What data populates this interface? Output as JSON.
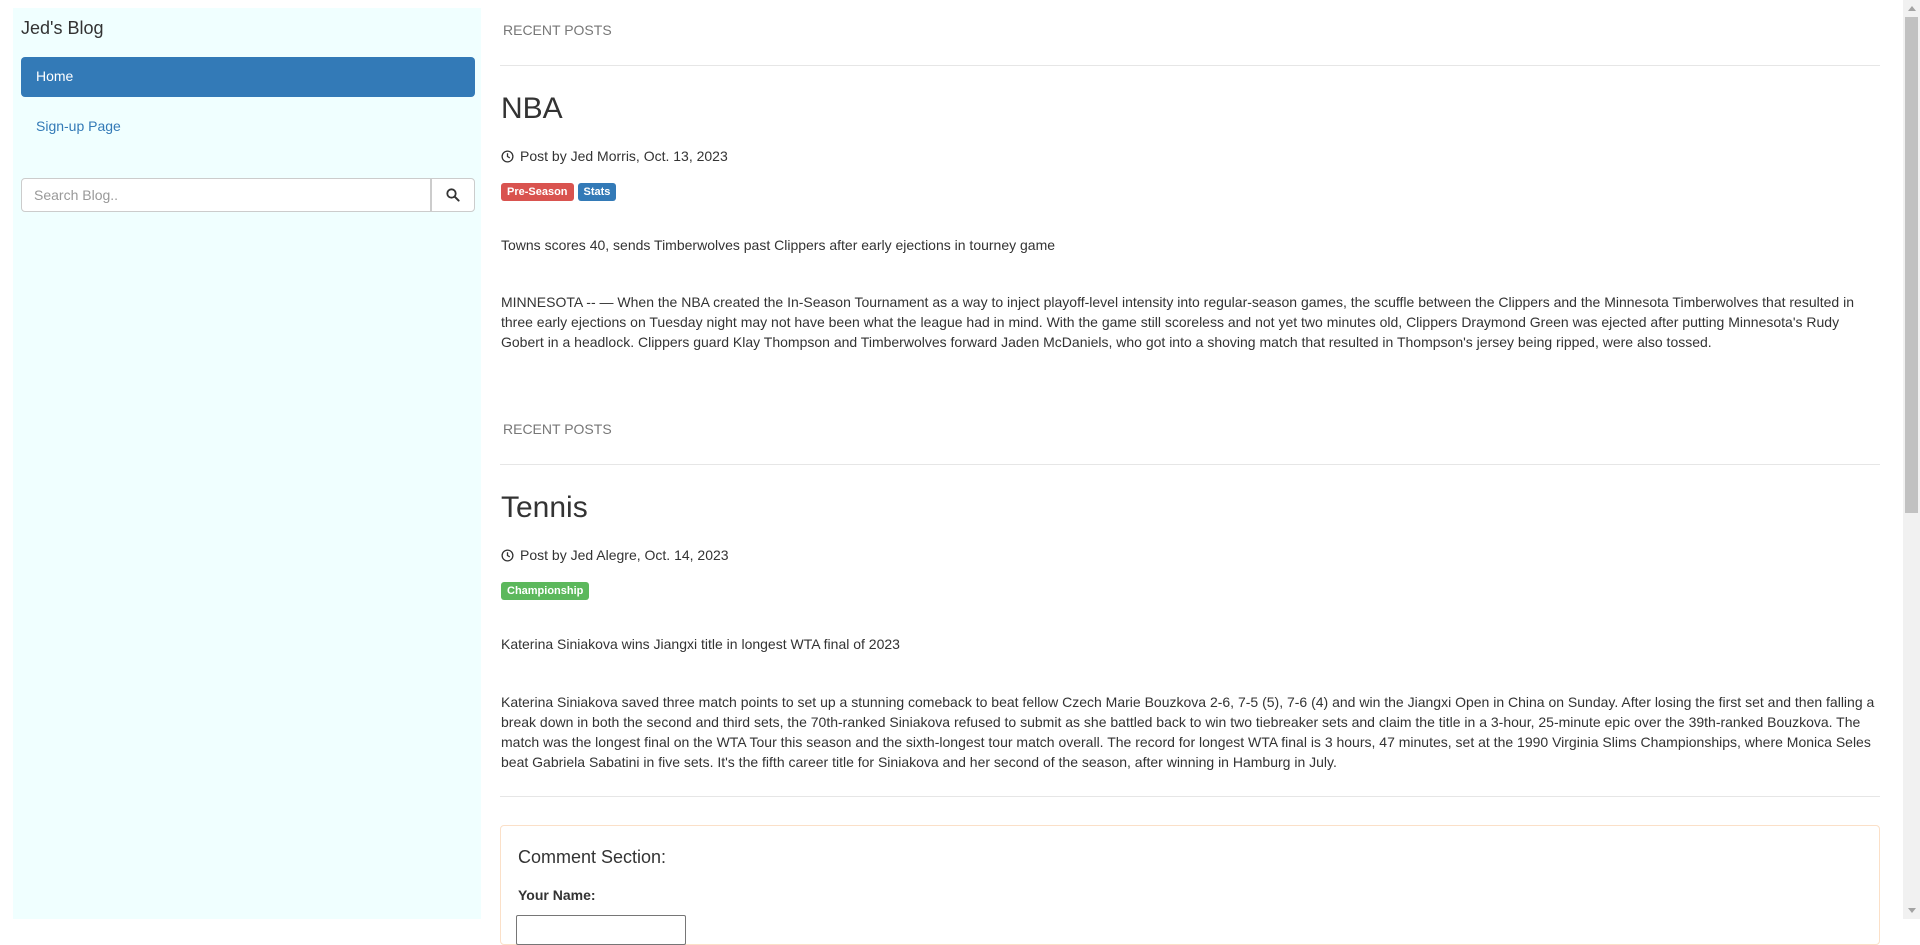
{
  "sidebar": {
    "blog_title": "Jed's Blog",
    "nav": [
      {
        "label": "Home",
        "active": true
      },
      {
        "label": "Sign-up Page",
        "active": false
      }
    ],
    "search": {
      "placeholder": "Search Blog..",
      "button_icon": "search-icon"
    }
  },
  "posts": [
    {
      "section_label": "RECENT POSTS",
      "title": "NBA",
      "meta_icon": "clock-icon",
      "meta": "Post by Jed Morris, Oct. 13, 2023",
      "tags": [
        {
          "label": "Pre-Season",
          "color": "#d9534f"
        },
        {
          "label": "Stats",
          "color": "#337ab7"
        }
      ],
      "subtitle": "Towns scores 40, sends Timberwolves past Clippers after early ejections in tourney game",
      "body": "MINNESOTA -- — When the NBA created the In-Season Tournament as a way to inject playoff-level intensity into regular-season games, the scuffle between the Clippers and the Minnesota Timberwolves that resulted in three early ejections on Tuesday night may not have been what the league had in mind. With the game still scoreless and not yet two minutes old, Clippers Draymond Green was ejected after putting Minnesota's Rudy Gobert in a headlock. Clippers guard Klay Thompson and Timberwolves forward Jaden McDaniels, who got into a shoving match that resulted in Thompson's jersey being ripped, were also tossed."
    },
    {
      "section_label": "RECENT POSTS",
      "title": "Tennis",
      "meta_icon": "clock-icon",
      "meta": "Post by Jed Alegre, Oct. 14, 2023",
      "tags": [
        {
          "label": "Championship",
          "color": "#5cb85c"
        }
      ],
      "subtitle": "Katerina Siniakova wins Jiangxi title in longest WTA final of 2023",
      "body": "Katerina Siniakova saved three match points to set up a stunning comeback to beat fellow Czech Marie Bouzkova 2-6, 7-5 (5), 7-6 (4) and win the Jiangxi Open in China on Sunday. After losing the first set and then falling a break down in both the second and third sets, the 70th-ranked Siniakova refused to submit as she battled back to win two tiebreaker sets and claim the title in a 3-hour, 25-minute epic over the 39th-ranked Bouzkova. The match was the longest final on the WTA Tour this season and the sixth-longest tour match overall. The record for longest WTA final is 3 hours, 47 minutes, set at the 1990 Virginia Slims Championships, where Monica Seles beat Gabriela Sabatini in five sets. It's the fifth career title for Siniakova and her second of the season, after winning in Hamburg in July."
    }
  ],
  "comments": {
    "title": "Comment Section:",
    "name_label": "Your Name:"
  }
}
